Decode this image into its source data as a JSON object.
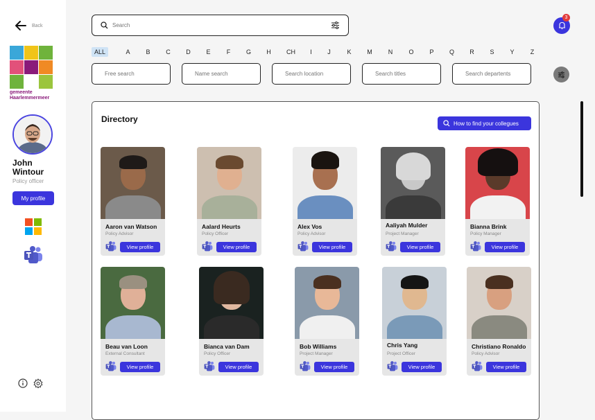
{
  "sidebar": {
    "back_label": "Back",
    "logo_text_line1": "gemeente",
    "logo_text_line2": "Haarlemmermeer",
    "user_name": "John Wintour",
    "user_role": "Policy officer",
    "my_profile_label": "My profile"
  },
  "header": {
    "search_placeholder": "Search",
    "notification_count": "3"
  },
  "alphabet": [
    "ALL",
    "A",
    "B",
    "C",
    "D",
    "E",
    "F",
    "G",
    "H",
    "CH",
    "I",
    "J",
    "K",
    "M",
    "N",
    "O",
    "P",
    "Q",
    "R",
    "S",
    "Y",
    "Z"
  ],
  "filters": {
    "free_search": "Free search",
    "name_search": "Name search",
    "location": "Search location",
    "titles": "Search titles",
    "departments": "Search departents"
  },
  "directory": {
    "title": "Directory",
    "howto_label": "How to find your collegues",
    "view_profile_label": "View profile",
    "people": [
      {
        "name": "Aaron van Watson",
        "role": "Policy Advisor"
      },
      {
        "name": "Aalard Heurts",
        "role": "Policy Officer"
      },
      {
        "name": "Alex Vos",
        "role": "Policy Advisor"
      },
      {
        "name": "Aaliyah Mulder",
        "role": "Project Manager"
      },
      {
        "name": "Bianna Brink",
        "role": "Policy Manager"
      },
      {
        "name": "Beau van Loon",
        "role": "External Consultant"
      },
      {
        "name": "Bianca van Dam",
        "role": "Policy Officer"
      },
      {
        "name": "Bob Williams",
        "role": "Project Manager"
      },
      {
        "name": "Chris Yang",
        "role": "Project Officer"
      },
      {
        "name": "Christiano Ronaldo",
        "role": "Policy Advisor"
      }
    ]
  },
  "colors": {
    "accent": "#3b35dd",
    "badge": "#e23b3b",
    "logo_text": "#8a1a7a"
  }
}
